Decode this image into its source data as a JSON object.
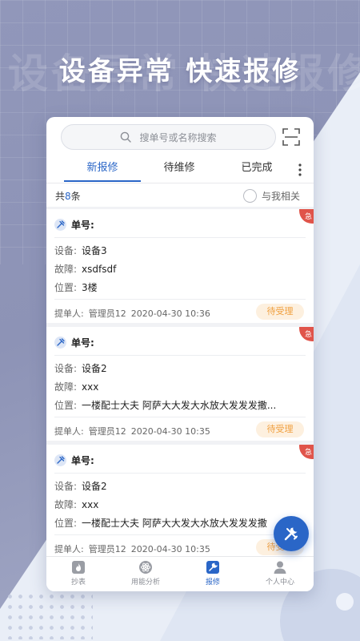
{
  "promo": {
    "headline": "设备异常 快速报修",
    "ghost_text": "设备异常 快速报修"
  },
  "search": {
    "placeholder": "搜单号或名称搜索",
    "icon": "search-icon",
    "scan_icon": "scan-icon"
  },
  "tabs": [
    {
      "label": "新报修",
      "active": true
    },
    {
      "label": "待维修",
      "active": false
    },
    {
      "label": "已完成",
      "active": false
    }
  ],
  "list_header": {
    "total_prefix": "共",
    "total_count": "8",
    "total_suffix": "条",
    "filter_label": "与我相关"
  },
  "orders": [
    {
      "urgent_label": "急",
      "order_label": "单号:",
      "device_label": "设备:",
      "device": "设备3",
      "fault_label": "故障:",
      "fault": "xsdfsdf",
      "location_label": "位置:",
      "location": "3楼",
      "submitter_label": "提单人:",
      "submitter": "管理员12",
      "time": "2020-04-30 10:36",
      "status": "待受理"
    },
    {
      "urgent_label": "急",
      "order_label": "单号:",
      "device_label": "设备:",
      "device": "设备2",
      "fault_label": "故障:",
      "fault": "xxx",
      "location_label": "位置:",
      "location": "一楼配士大夫 阿萨大大发大水放大发发发撒...",
      "submitter_label": "提单人:",
      "submitter": "管理员12",
      "time": "2020-04-30 10:35",
      "status": "待受理"
    },
    {
      "urgent_label": "急",
      "order_label": "单号:",
      "device_label": "设备:",
      "device": "设备2",
      "fault_label": "故障:",
      "fault": "xxx",
      "location_label": "位置:",
      "location": "一楼配士大夫 阿萨大大发大水放大发发发撒",
      "submitter_label": "提单人:",
      "submitter": "管理员12",
      "time": "2020-04-30 10:35",
      "status": "待受理"
    }
  ],
  "bottom_nav": [
    {
      "label": "抄表",
      "icon": "fire-icon",
      "active": false
    },
    {
      "label": "用能分析",
      "icon": "atom-icon",
      "active": false
    },
    {
      "label": "报修",
      "icon": "wrench-icon",
      "active": true
    },
    {
      "label": "个人中心",
      "icon": "user-icon",
      "active": false
    }
  ],
  "colors": {
    "accent": "#2a66c7",
    "urgent": "#e0544a",
    "status_text": "#f0a040",
    "status_bg": "#fdf0df"
  }
}
